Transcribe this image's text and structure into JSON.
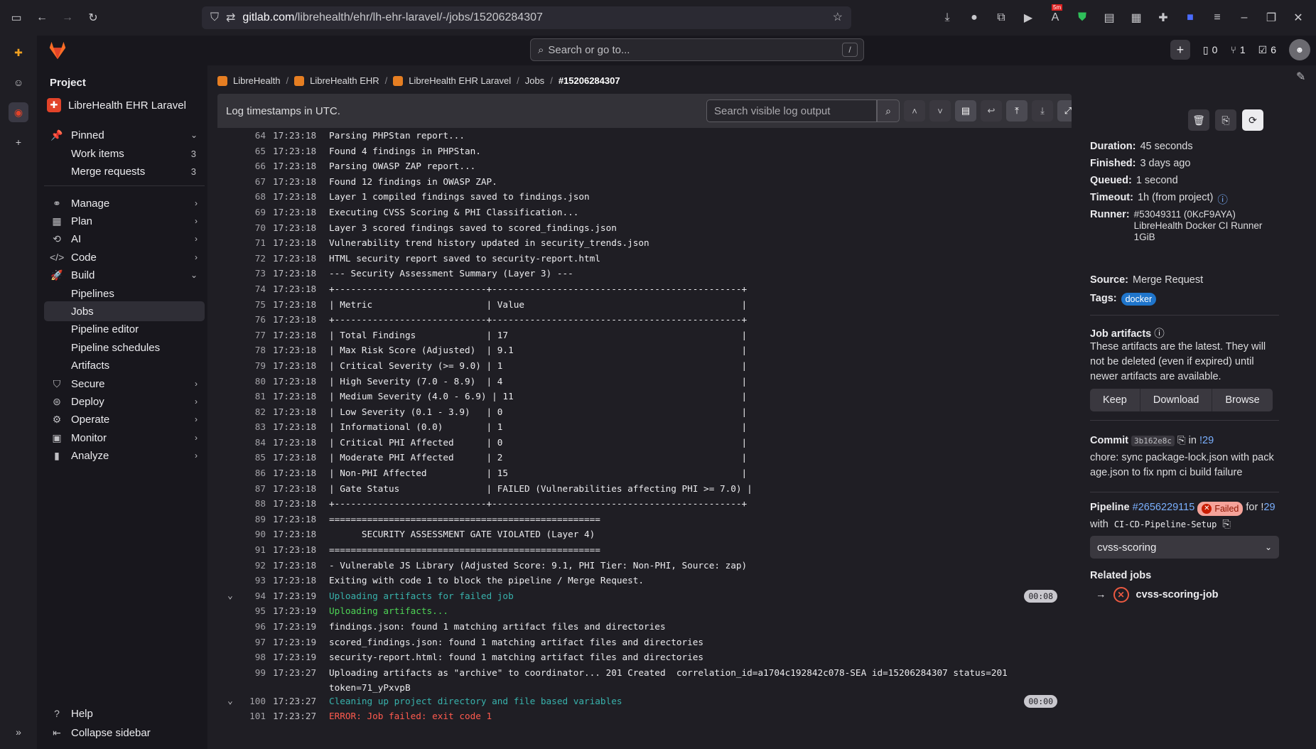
{
  "browser": {
    "url_host": "gitlab.com",
    "url_path": "/librehealth/ehr/lh-ehr-laravel/-/jobs/15206284307",
    "badge": "5m"
  },
  "topbar": {
    "search_placeholder": "Search or go to...",
    "search_shortcut": "/",
    "issues_count": "0",
    "mr_count": "1",
    "todo_count": "6"
  },
  "nav": {
    "section_title": "Project",
    "project_name": "LibreHealth EHR Laravel",
    "pinned": "Pinned",
    "work_items": "Work items",
    "work_items_count": "3",
    "merge_requests": "Merge requests",
    "merge_requests_count": "3",
    "manage": "Manage",
    "plan": "Plan",
    "ai": "AI",
    "code": "Code",
    "build": "Build",
    "pipelines": "Pipelines",
    "jobs": "Jobs",
    "pipeline_editor": "Pipeline editor",
    "pipeline_schedules": "Pipeline schedules",
    "artifacts": "Artifacts",
    "secure": "Secure",
    "deploy": "Deploy",
    "operate": "Operate",
    "monitor": "Monitor",
    "analyze": "Analyze",
    "help": "Help",
    "collapse": "Collapse sidebar"
  },
  "breadcrumb": [
    "LibreHealth",
    "LibreHealth EHR",
    "LibreHealth EHR Laravel",
    "Jobs",
    "#15206284307"
  ],
  "log": {
    "header": "Log timestamps in UTC.",
    "search_placeholder": "Search visible log output",
    "lines": [
      {
        "n": "64",
        "t": "17:23:18",
        "text": "Parsing PHPStan report..."
      },
      {
        "n": "65",
        "t": "17:23:18",
        "text": "Found 4 findings in PHPStan."
      },
      {
        "n": "66",
        "t": "17:23:18",
        "text": "Parsing OWASP ZAP report..."
      },
      {
        "n": "67",
        "t": "17:23:18",
        "text": "Found 12 findings in OWASP ZAP."
      },
      {
        "n": "68",
        "t": "17:23:18",
        "text": "Layer 1 compiled findings saved to findings.json"
      },
      {
        "n": "69",
        "t": "17:23:18",
        "text": "Executing CVSS Scoring & PHI Classification..."
      },
      {
        "n": "70",
        "t": "17:23:18",
        "text": "Layer 3 scored findings saved to scored_findings.json"
      },
      {
        "n": "71",
        "t": "17:23:18",
        "text": "Vulnerability trend history updated in security_trends.json"
      },
      {
        "n": "72",
        "t": "17:23:18",
        "text": "HTML security report saved to security-report.html"
      },
      {
        "n": "73",
        "t": "17:23:18",
        "text": "--- Security Assessment Summary (Layer 3) ---"
      },
      {
        "n": "74",
        "t": "17:23:18",
        "text": "+----------------------------+----------------------------------------------+"
      },
      {
        "n": "75",
        "t": "17:23:18",
        "text": "| Metric                     | Value                                        |"
      },
      {
        "n": "76",
        "t": "17:23:18",
        "text": "+----------------------------+----------------------------------------------+"
      },
      {
        "n": "77",
        "t": "17:23:18",
        "text": "| Total Findings             | 17                                           |"
      },
      {
        "n": "78",
        "t": "17:23:18",
        "text": "| Max Risk Score (Adjusted)  | 9.1                                          |"
      },
      {
        "n": "79",
        "t": "17:23:18",
        "text": "| Critical Severity (>= 9.0) | 1                                            |"
      },
      {
        "n": "80",
        "t": "17:23:18",
        "text": "| High Severity (7.0 - 8.9)  | 4                                            |"
      },
      {
        "n": "81",
        "t": "17:23:18",
        "text": "| Medium Severity (4.0 - 6.9) | 11                                          |"
      },
      {
        "n": "82",
        "t": "17:23:18",
        "text": "| Low Severity (0.1 - 3.9)   | 0                                            |"
      },
      {
        "n": "83",
        "t": "17:23:18",
        "text": "| Informational (0.0)        | 1                                            |"
      },
      {
        "n": "84",
        "t": "17:23:18",
        "text": "| Critical PHI Affected      | 0                                            |"
      },
      {
        "n": "85",
        "t": "17:23:18",
        "text": "| Moderate PHI Affected      | 2                                            |"
      },
      {
        "n": "86",
        "t": "17:23:18",
        "text": "| Non-PHI Affected           | 15                                           |"
      },
      {
        "n": "87",
        "t": "17:23:18",
        "text": "| Gate Status                | FAILED (Vulnerabilities affecting PHI >= 7.0) |"
      },
      {
        "n": "88",
        "t": "17:23:18",
        "text": "+----------------------------+----------------------------------------------+"
      },
      {
        "n": "89",
        "t": "17:23:18",
        "text": "=================================================="
      },
      {
        "n": "90",
        "t": "17:23:18",
        "text": "      SECURITY ASSESSMENT GATE VIOLATED (Layer 4)"
      },
      {
        "n": "91",
        "t": "17:23:18",
        "text": "=================================================="
      },
      {
        "n": "92",
        "t": "17:23:18",
        "text": "- Vulnerable JS Library (Adjusted Score: 9.1, PHI Tier: Non-PHI, Source: zap)"
      },
      {
        "n": "93",
        "t": "17:23:18",
        "text": "Exiting with code 1 to block the pipeline / Merge Request."
      },
      {
        "n": "94",
        "t": "17:23:19",
        "text": "Uploading artifacts for failed job",
        "style": "cyan",
        "toggle": true,
        "dur": "00:08"
      },
      {
        "n": "95",
        "t": "17:23:19",
        "text": "Uploading artifacts...",
        "style": "green"
      },
      {
        "n": "96",
        "t": "17:23:19",
        "text": "findings.json: found 1 matching artifact files and directories"
      },
      {
        "n": "97",
        "t": "17:23:19",
        "text": "scored_findings.json: found 1 matching artifact files and directories"
      },
      {
        "n": "98",
        "t": "17:23:19",
        "text": "security-report.html: found 1 matching artifact files and directories"
      },
      {
        "n": "99",
        "t": "17:23:27",
        "text": "Uploading artifacts as \"archive\" to coordinator... 201 Created  correlation_id=a1704c192842c078-SEA id=15206284307 status=201 token=71_yPxvpB",
        "tall": true
      },
      {
        "n": "100",
        "t": "17:23:27",
        "text": "Cleaning up project directory and file based variables",
        "style": "cyan",
        "toggle": true,
        "dur": "00:00"
      },
      {
        "n": "101",
        "t": "17:23:27",
        "text": "ERROR: Job failed: exit code 1",
        "style": "red"
      }
    ]
  },
  "job": {
    "duration_label": "Duration:",
    "duration": "45 seconds",
    "finished_label": "Finished:",
    "finished": "3 days ago",
    "queued_label": "Queued:",
    "queued": "1 second",
    "timeout_label": "Timeout:",
    "timeout": "1h (from project)",
    "runner_label": "Runner:",
    "runner": "#53049311 (0KcF9AYA) LibreHealth Docker CI Runner 1GiB",
    "source_label": "Source:",
    "source": "Merge Request",
    "tags_label": "Tags:",
    "tag": "docker",
    "artifacts_title": "Job artifacts",
    "artifacts_text": "These artifacts are the latest. They will not be deleted (even if expired) until newer artifacts are available.",
    "keep": "Keep",
    "download": "Download",
    "browse": "Browse",
    "commit_label": "Commit",
    "commit_sha": "3b162e8c",
    "commit_in": "in",
    "commit_mr": "!29",
    "commit_message": "chore: sync package-lock.json with package.json to fix npm ci build failure",
    "pipeline_label": "Pipeline",
    "pipeline_id": "#2656229115",
    "pipeline_status": "Failed",
    "pipeline_for": "for !",
    "pipeline_mr": "29",
    "pipeline_with": "with",
    "pipeline_branch": "CI-CD-Pipeline-Setup",
    "stage": "cvss-scoring",
    "related_title": "Related jobs",
    "related_job": "cvss-scoring-job"
  }
}
